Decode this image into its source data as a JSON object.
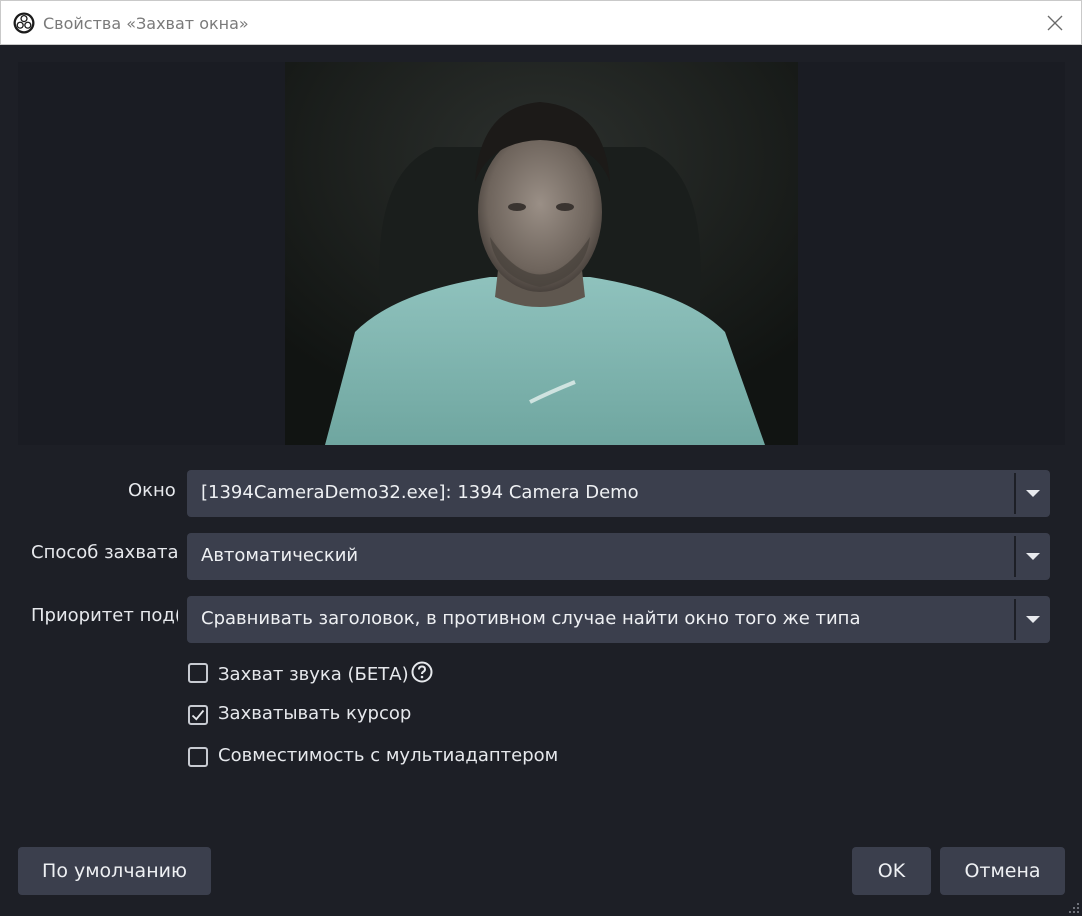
{
  "window": {
    "title": "Свойства «Захват окна»",
    "close_icon": "close-icon",
    "app_icon": "obs-logo-icon"
  },
  "form": {
    "window_field": {
      "label": "Окно",
      "value": "[1394CameraDemo32.exe]: 1394 Camera Demo"
    },
    "capture_method": {
      "label": "Способ захвата",
      "value": "Автоматический"
    },
    "window_match_priority": {
      "label": "Приоритет под(",
      "value": "Сравнивать заголовок, в противном случае найти окно того же типа"
    },
    "checkboxes": [
      {
        "label": "Захват звука (БЕТА)",
        "checked": false,
        "has_help_icon": true
      },
      {
        "label": "Захватывать курсор",
        "checked": true,
        "has_help_icon": false
      },
      {
        "label": "Совместимость с мультиадаптером",
        "checked": false,
        "has_help_icon": false
      }
    ]
  },
  "buttons": {
    "defaults": "По умолчанию",
    "ok": "OK",
    "cancel": "Отмена"
  },
  "colors": {
    "background": "#1d1f26",
    "control": "#3b3f4d",
    "text": "#e6e8ec"
  }
}
